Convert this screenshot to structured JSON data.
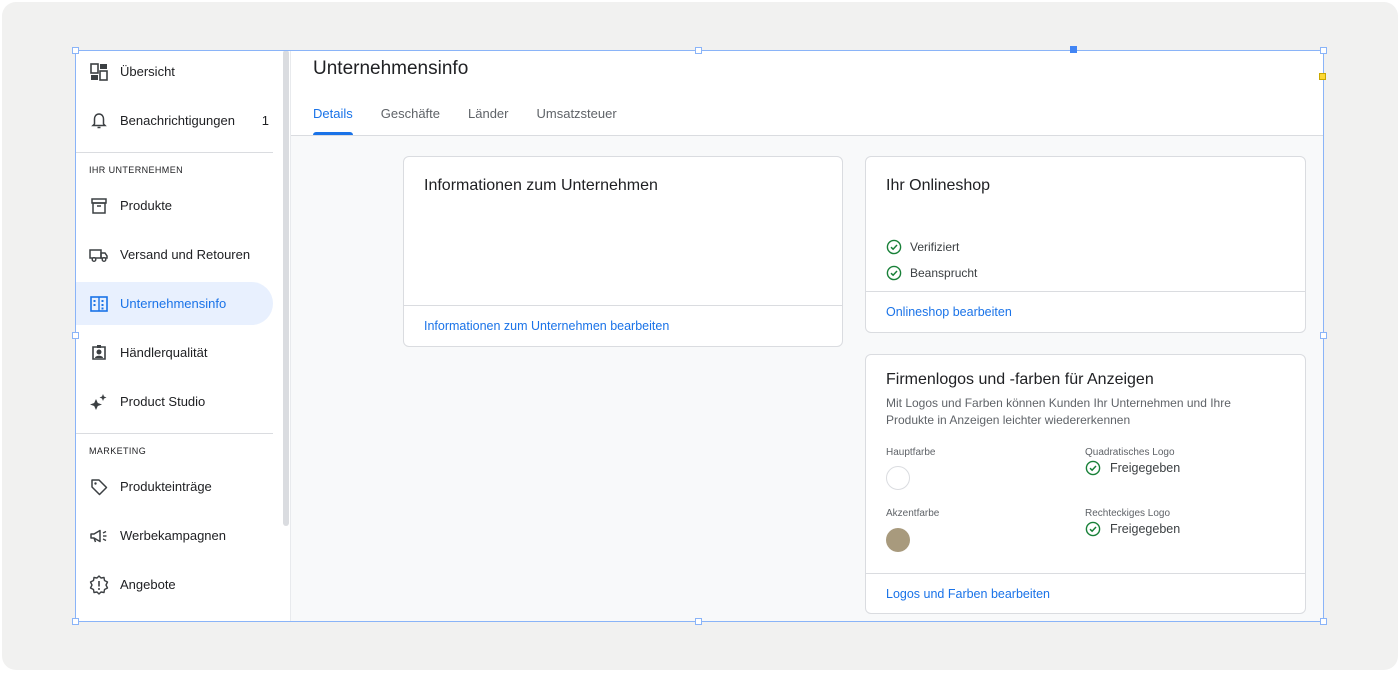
{
  "sidebar": {
    "items": [
      {
        "label": "Übersicht",
        "icon": "dashboard-icon"
      },
      {
        "label": "Benachrichtigungen",
        "icon": "bell-icon",
        "badge": "1"
      },
      {
        "label": "Produkte",
        "icon": "archive-icon"
      },
      {
        "label": "Versand und Retouren",
        "icon": "truck-icon"
      },
      {
        "label": "Unternehmensinfo",
        "icon": "building-icon",
        "active": true
      },
      {
        "label": "Händlerqualität",
        "icon": "badge-icon"
      },
      {
        "label": "Product Studio",
        "icon": "sparkle-icon"
      },
      {
        "label": "Produkteinträge",
        "icon": "tag-icon"
      },
      {
        "label": "Werbekampagnen",
        "icon": "megaphone-icon"
      },
      {
        "label": "Angebote",
        "icon": "offer-icon"
      }
    ],
    "sections": {
      "business": "IHR UNTERNEHMEN",
      "marketing": "MARKETING"
    }
  },
  "header": {
    "title": "Unternehmensinfo",
    "tabs": [
      {
        "label": "Details",
        "active": true
      },
      {
        "label": "Geschäfte"
      },
      {
        "label": "Länder"
      },
      {
        "label": "Umsatzsteuer"
      }
    ]
  },
  "cards": {
    "company_info": {
      "title": "Informationen zum Unternehmen",
      "link": "Informationen zum Unternehmen bearbeiten"
    },
    "online_shop": {
      "title": "Ihr Onlineshop",
      "statuses": [
        "Verifiziert",
        "Beansprucht"
      ],
      "link": "Onlineshop bearbeiten"
    },
    "logos": {
      "title": "Firmenlogos und -farben für Anzeigen",
      "description": "Mit Logos und Farben können Kunden Ihr Unternehmen und Ihre Produkte in Anzeigen leichter wiedererkennen",
      "main_color_label": "Hauptfarbe",
      "main_color": "#ffffff",
      "accent_color_label": "Akzentfarbe",
      "accent_color": "#a89a7d",
      "square_logo_label": "Quadratisches Logo",
      "square_logo_status": "Freigegeben",
      "rect_logo_label": "Rechteckiges Logo",
      "rect_logo_status": "Freigegeben",
      "link": "Logos und Farben bearbeiten"
    }
  },
  "colors": {
    "accent": "#1a73e8",
    "success": "#188038"
  }
}
